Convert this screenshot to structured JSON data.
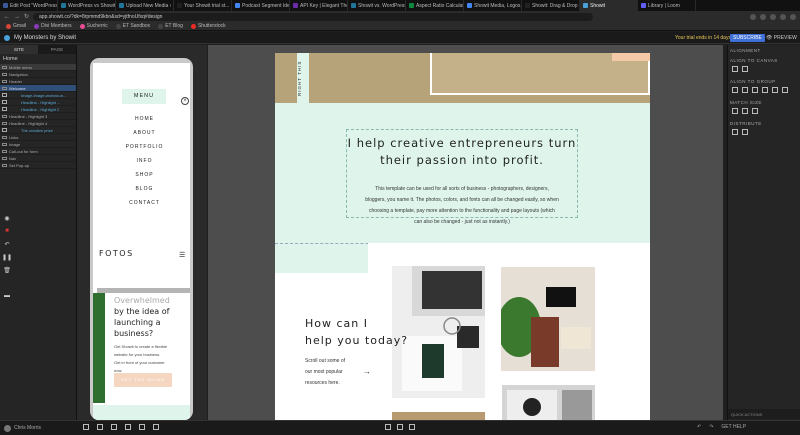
{
  "browser": {
    "tabs": [
      {
        "label": "Edit Post \"WordPress vs...",
        "color": "#3b5998"
      },
      {
        "label": "WordPress vs Showit | ...",
        "color": "#21759b"
      },
      {
        "label": "Upload New Media ‹ D...",
        "color": "#21759b"
      },
      {
        "label": "Your Showit trial st...",
        "color": "#1f1f1f"
      },
      {
        "label": "Podcast Segment Ideas",
        "color": "#4285f4"
      },
      {
        "label": "API Key | Elegant Them...",
        "color": "#6b2aa8"
      },
      {
        "label": "Showit vs. WordPress |...",
        "color": "#21759b"
      },
      {
        "label": "Aspect Ratio Calculatio...",
        "color": "#0b8a3f"
      },
      {
        "label": "Showit Media, Logos, ...",
        "color": "#4285f4"
      },
      {
        "label": "Showit: Drag & Drop W...",
        "color": "#222"
      },
      {
        "label": "Showit",
        "color": "#4aa0d8"
      },
      {
        "label": "Library | Loom",
        "color": "#625df5"
      }
    ],
    "url": "app.showit.co/?dk=8rpmmd9kbn&sd=yjtfnoUfxq#design",
    "bookmarks": [
      {
        "label": "Gmail",
        "color": "#d44638"
      },
      {
        "label": "Divi Members",
        "color": "#8a3ab9"
      },
      {
        "label": "Sucherric",
        "color": "#e94b97"
      },
      {
        "label": "ET Sandbox",
        "color": "#444"
      },
      {
        "label": "ET Blog",
        "color": "#444"
      },
      {
        "label": "Shutterstock",
        "color": "#ee2b24"
      }
    ]
  },
  "app": {
    "site_name": "My Monsters by Showit",
    "trial_text": "Your trial ends in 14 days",
    "subscribe_label": "SUBSCRIBE",
    "preview_label": "PREVIEW"
  },
  "left_panel": {
    "tabs": [
      "SITE",
      "PAGE"
    ],
    "home_label": "Home",
    "layers": [
      {
        "label": "Mobile menu",
        "type": "hl2"
      },
      {
        "label": "Navigation",
        "type": "normal"
      },
      {
        "label": "Header",
        "type": "normal"
      },
      {
        "label": "Welcome",
        "type": "hl"
      },
      {
        "label": "Image-Image-woman-w...",
        "type": "sub"
      },
      {
        "label": "Headline - Highlight ...",
        "type": "sub"
      },
      {
        "label": "Headline - Highlight 2",
        "type": "sub"
      },
      {
        "label": "Headline - Highlight 3",
        "type": "normal"
      },
      {
        "label": "Headline - Highlight 4",
        "type": "normal"
      },
      {
        "label": "The creative prize",
        "type": "sub"
      },
      {
        "label": "Links",
        "type": "normal"
      },
      {
        "label": "Image",
        "type": "normal"
      },
      {
        "label": "Call-out for form",
        "type": "normal"
      },
      {
        "label": "Nav",
        "type": "normal"
      },
      {
        "label": "Set Pop-up",
        "type": "normal"
      }
    ]
  },
  "mobile_preview": {
    "menu_title": "MENU",
    "menu_items": [
      "HOME",
      "ABOUT",
      "PORTFOLIO",
      "INFO",
      "SHOP",
      "BLOG",
      "CONTACT"
    ],
    "logo": "FOTOS",
    "headline_faded": "Overwhelmed",
    "headline_lines": [
      "by the idea of",
      "launching a",
      "business?"
    ],
    "text_lines": [
      "Get Showit to create a flexible",
      "website for your business.",
      "Get in front of your customer",
      "now."
    ],
    "button_label": "GET THE GUIDE"
  },
  "canvas": {
    "vertical_text": "RIGHT THIS",
    "heading_lines": [
      "I help creative entrepreneurs turn",
      "their passion into profit."
    ],
    "paragraph_lines": [
      "This template can be used for all sorts of business - photographers, designers,",
      "bloggers, you name it. The photos, colors, and fonts can all be changed easily, so when",
      "choosing a template, pay more attention to the functionality and page layouts (which",
      "can also be changed - just not as instantly.)"
    ],
    "section_heading_lines": [
      "How can I",
      "help you today?"
    ],
    "section_text_lines": [
      "Scroll out some of",
      "our most popular",
      "resources here."
    ],
    "arrow_glyph": "→"
  },
  "right_panel": {
    "sections": [
      "ALIGNMENT",
      "ALIGN TO CANVAS",
      "ALIGN TO GROUP",
      "MATCH SIZE",
      "DISTRIBUTE"
    ],
    "footer_label": "QUICK ACTIONS"
  },
  "bottom_bar": {
    "user": "Chris Morris",
    "help_label": "GET HELP"
  }
}
